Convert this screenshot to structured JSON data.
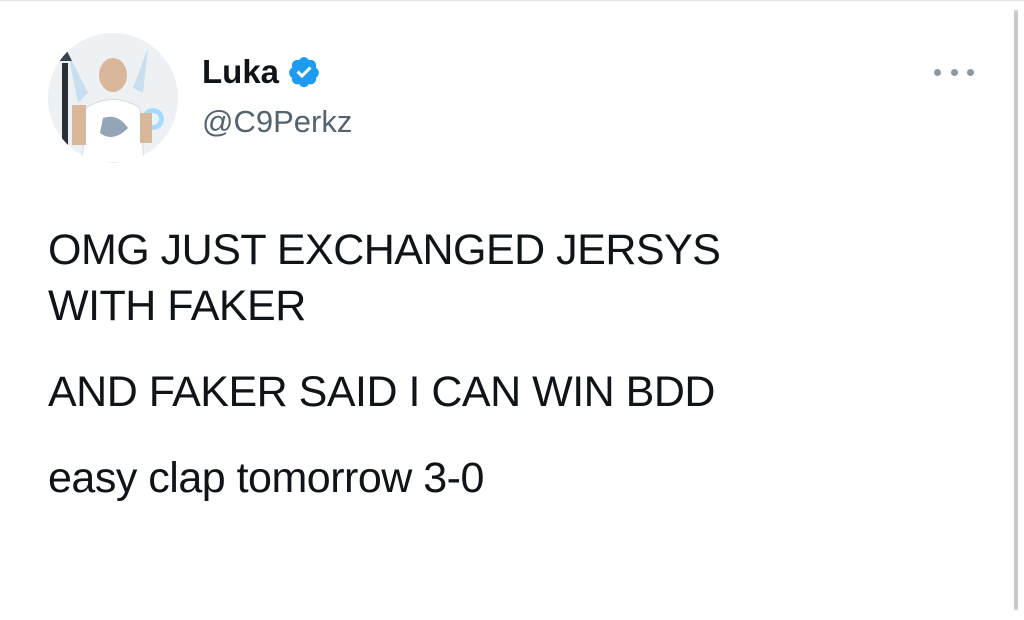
{
  "tweet": {
    "author": {
      "display_name": "Luka",
      "handle": "@C9Perkz",
      "verified": true,
      "avatar_icon": "avatar-photo"
    },
    "more_icon": "more-options-icon",
    "body": {
      "line1": "OMG JUST EXCHANGED JERSYS",
      "line2": "WITH FAKER",
      "line3": "AND FAKER SAID I CAN WIN BDD",
      "line4": "easy clap tomorrow 3-0"
    }
  },
  "colors": {
    "text": "#0f1419",
    "secondary": "#536471",
    "verified": "#1d9bf0"
  }
}
